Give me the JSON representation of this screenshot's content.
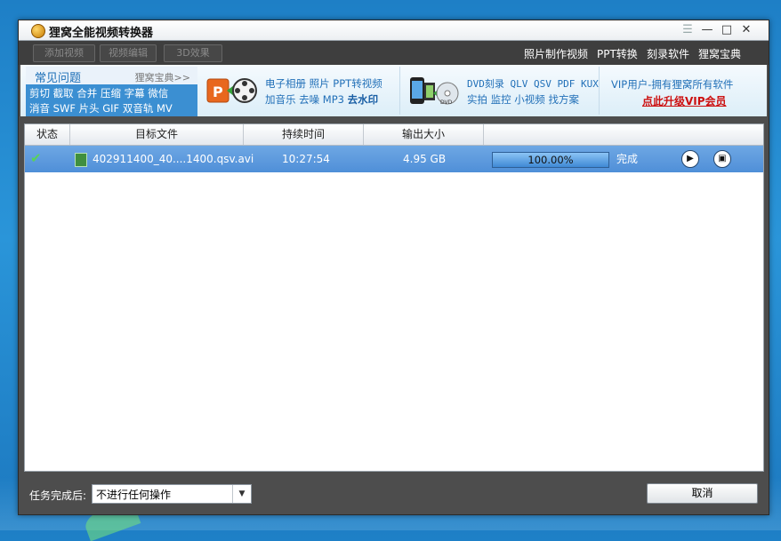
{
  "app": {
    "title": "狸窝全能视频转换器"
  },
  "toolbar": {
    "add_video": "添加视频",
    "edit_video": "视频编辑",
    "effect_3d": "3D效果",
    "links": [
      "照片制作视频",
      "PPT转换",
      "刻录软件",
      "狸窝宝典"
    ]
  },
  "faq": {
    "title": "常见问题",
    "more": "狸窝宝典>>",
    "row1": "剪切 截取 合并 压缩 字幕 微信",
    "row2": "消音 SWF 片头 GIF 双音轨 MV"
  },
  "promo": {
    "ppt_line1": "电子相册 照片 PPT转视频",
    "ppt_line2": "加音乐 去噪 MP3 ",
    "ppt_bold": "去水印",
    "dvd_line1": "DVD刻录 QLV QSV PDF KUX",
    "dvd_line2": "实拍 监控 小视频 找方案",
    "vip_line1": "VIP用户-拥有狸窝所有软件",
    "vip_link": "点此升级VIP会员"
  },
  "table": {
    "headers": [
      "状态",
      "目标文件",
      "持续时间",
      "输出大小"
    ],
    "row": {
      "file": "402911400_40....1400.qsv.avi",
      "duration": "10:27:54",
      "size": "4.95 GB",
      "progress_text": "100.00%",
      "progress": 1.0,
      "status_text": "完成"
    }
  },
  "footer": {
    "after_label": "任务完成后:",
    "after_value": "不进行任何操作",
    "cancel": "取消"
  },
  "colors": {
    "accent": "#3b8fd2",
    "row_selected": "#5b97dc",
    "vip_red": "#cc1010"
  },
  "icons": [
    "app-icon",
    "menu-icon",
    "minimize-icon",
    "maximize-icon",
    "close-icon",
    "ppt-film-icon",
    "phone-dvd-icon",
    "check-icon",
    "film-file-icon",
    "play-icon",
    "folder-icon",
    "dropdown-arrow-icon"
  ]
}
